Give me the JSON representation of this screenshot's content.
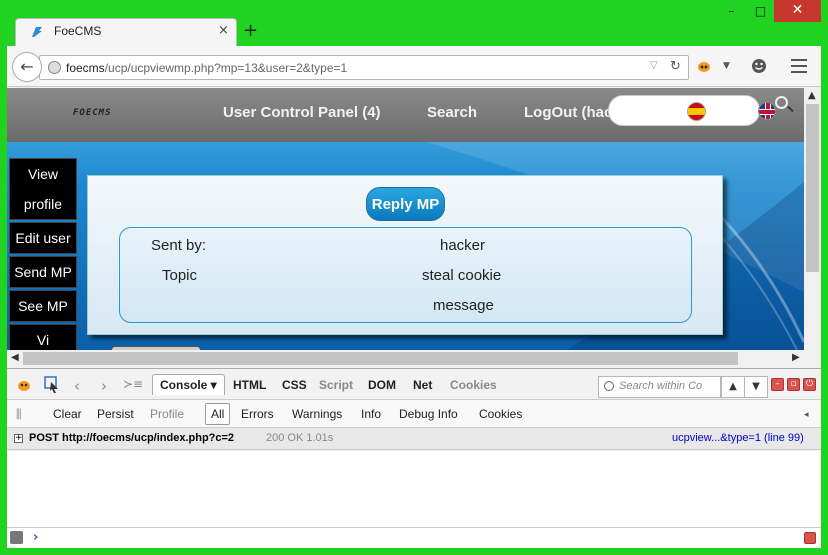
{
  "browser": {
    "tab_title": "FoeCMS",
    "tab_close": "×",
    "new_tab": "+",
    "url_host": "foecms",
    "url_path": "/ucp/ucpviewmp.php?mp=13&user=2&type=1",
    "window_controls": {
      "minimize": "–",
      "maximize": "□",
      "close": "✕"
    }
  },
  "site": {
    "logo_text": "FOECMS",
    "menu": {
      "ucp": "User Control Panel (4)",
      "search": "Search",
      "logout": "LogOut (hac"
    },
    "side_menu": [
      "View profile",
      "Edit user",
      "Send MP",
      "See MP",
      "Vi"
    ],
    "reply_button": "Reply MP",
    "message": {
      "sent_by_label": "Sent by:",
      "sent_by_value": "hacker",
      "topic_label": "Topic",
      "topic_value": "steal cookie",
      "body_value": "message"
    }
  },
  "firebug": {
    "tabs": [
      {
        "label": "Console ▾",
        "state": "active"
      },
      {
        "label": "HTML",
        "state": "normal"
      },
      {
        "label": "CSS",
        "state": "normal"
      },
      {
        "label": "Script",
        "state": "dim"
      },
      {
        "label": "DOM",
        "state": "normal"
      },
      {
        "label": "Net",
        "state": "normal"
      },
      {
        "label": "Cookies",
        "state": "dim"
      }
    ],
    "search_placeholder": "Search within Co",
    "sub": {
      "clear": "Clear",
      "persist": "Persist",
      "profile": "Profile",
      "all": "All",
      "errors": "Errors",
      "warnings": "Warnings",
      "info": "Info",
      "debug": "Debug Info",
      "cookies": "Cookies"
    },
    "log": {
      "request": "POST http://foecms/ucp/index.php?c=2",
      "status": "200 OK 1.01s",
      "source": "ucpview...&type=1 (line 99)"
    },
    "prompt": "›"
  },
  "colors": {
    "frame": "#21d321",
    "accent_button": "#0b78bc",
    "close_red": "#c7382c",
    "link_blue": "#0000d0"
  }
}
